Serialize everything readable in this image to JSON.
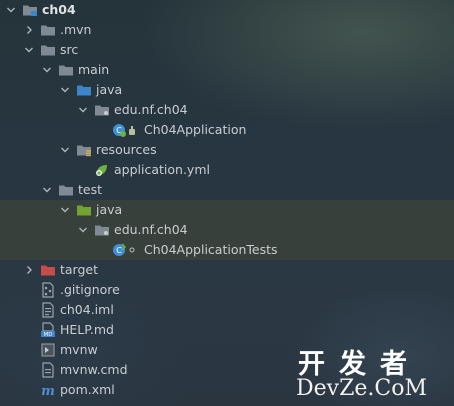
{
  "tree": [
    {
      "label": "ch04",
      "depth": 0,
      "expanded": true,
      "icon": "module-folder-icon",
      "bold": true
    },
    {
      "label": ".mvn",
      "depth": 1,
      "expanded": false,
      "icon": "folder-icon"
    },
    {
      "label": "src",
      "depth": 1,
      "expanded": true,
      "icon": "folder-icon"
    },
    {
      "label": "main",
      "depth": 2,
      "expanded": true,
      "icon": "folder-icon"
    },
    {
      "label": "java",
      "depth": 3,
      "expanded": true,
      "icon": "source-folder-icon"
    },
    {
      "label": "edu.nf.ch04",
      "depth": 4,
      "expanded": true,
      "icon": "package-icon"
    },
    {
      "label": "Ch04Application",
      "depth": 5,
      "leaf": true,
      "icon": "spring-boot-class-icon"
    },
    {
      "label": "resources",
      "depth": 3,
      "expanded": true,
      "icon": "resources-folder-icon"
    },
    {
      "label": "application.yml",
      "depth": 4,
      "leaf": true,
      "icon": "spring-yml-icon"
    },
    {
      "label": "test",
      "depth": 2,
      "expanded": true,
      "icon": "folder-icon"
    },
    {
      "label": "java",
      "depth": 3,
      "expanded": true,
      "icon": "test-source-folder-icon",
      "highlight": true
    },
    {
      "label": "edu.nf.ch04",
      "depth": 4,
      "expanded": true,
      "icon": "package-icon",
      "highlight": true
    },
    {
      "label": "Ch04ApplicationTests",
      "depth": 5,
      "leaf": true,
      "icon": "test-class-icon",
      "highlight": true
    },
    {
      "label": "target",
      "depth": 1,
      "expanded": false,
      "icon": "excluded-folder-icon"
    },
    {
      "label": ".gitignore",
      "depth": 1,
      "leaf": true,
      "icon": "gitignore-file-icon"
    },
    {
      "label": "ch04.iml",
      "depth": 1,
      "leaf": true,
      "icon": "iml-file-icon"
    },
    {
      "label": "HELP.md",
      "depth": 1,
      "leaf": true,
      "icon": "markdown-file-icon"
    },
    {
      "label": "mvnw",
      "depth": 1,
      "leaf": true,
      "icon": "script-file-icon"
    },
    {
      "label": "mvnw.cmd",
      "depth": 1,
      "leaf": true,
      "icon": "cmd-file-icon"
    },
    {
      "label": "pom.xml",
      "depth": 1,
      "leaf": true,
      "icon": "maven-pom-icon"
    }
  ],
  "watermark": {
    "top": "开发者",
    "bottom": "DevZe.CoM"
  },
  "colors": {
    "folder": "#7f8a94",
    "source_folder": "#3c85c6",
    "test_folder": "#73a332",
    "excluded_folder": "#c44e47",
    "resources_bar": "#d8a657",
    "spring_green": "#6cb33f",
    "class_blue": "#3f8fd6",
    "highlight_row": "#3e443a"
  }
}
